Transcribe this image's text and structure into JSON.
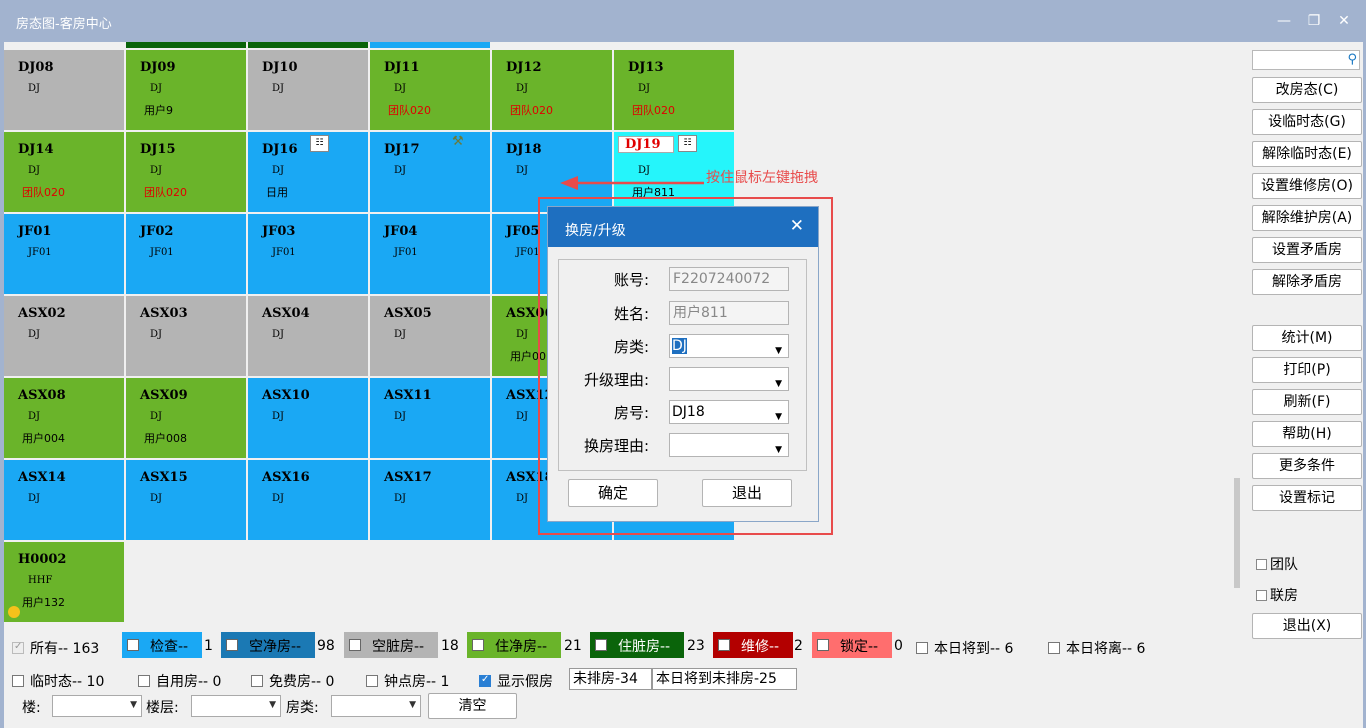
{
  "window": {
    "title": "房态图-客房中心",
    "minimize": "—",
    "restore": "❐",
    "close": "✕"
  },
  "rooms": [
    {
      "no": "DJ08",
      "type": "DJ",
      "guest": "",
      "color": "gray"
    },
    {
      "no": "DJ09",
      "type": "DJ",
      "guest": "用户9",
      "color": "green"
    },
    {
      "no": "DJ10",
      "type": "DJ",
      "guest": "",
      "color": "gray"
    },
    {
      "no": "DJ11",
      "type": "DJ",
      "guest": "团队020",
      "color": "green",
      "guestRed": true
    },
    {
      "no": "DJ12",
      "type": "DJ",
      "guest": "团队020",
      "color": "green",
      "guestRed": true
    },
    {
      "no": "DJ13",
      "type": "DJ",
      "guest": "团队020",
      "color": "green",
      "guestRed": true
    },
    {
      "no": "DJ14",
      "type": "DJ",
      "guest": "团队020",
      "color": "green",
      "guestRed": true
    },
    {
      "no": "DJ15",
      "type": "DJ",
      "guest": "团队020",
      "color": "green",
      "guestRed": true
    },
    {
      "no": "DJ16",
      "type": "DJ",
      "guest": "日用",
      "color": "blue"
    },
    {
      "no": "DJ17",
      "type": "DJ",
      "guest": "",
      "color": "blue"
    },
    {
      "no": "DJ18",
      "type": "DJ",
      "guest": "",
      "color": "blue"
    },
    {
      "no": "DJ19",
      "type": "DJ",
      "guest": "用户811",
      "color": "cyan"
    },
    {
      "no": "JF01",
      "type": "JF01",
      "guest": "",
      "color": "blue"
    },
    {
      "no": "JF02",
      "type": "JF01",
      "guest": "",
      "color": "blue"
    },
    {
      "no": "JF03",
      "type": "JF01",
      "guest": "",
      "color": "blue"
    },
    {
      "no": "JF04",
      "type": "JF01",
      "guest": "",
      "color": "blue"
    },
    {
      "no": "JF05",
      "type": "JF01",
      "guest": "",
      "color": "blue"
    },
    {
      "no": "",
      "type": "",
      "guest": "",
      "color": "blue"
    },
    {
      "no": "ASX02",
      "type": "DJ",
      "guest": "",
      "color": "gray"
    },
    {
      "no": "ASX03",
      "type": "DJ",
      "guest": "",
      "color": "gray"
    },
    {
      "no": "ASX04",
      "type": "DJ",
      "guest": "",
      "color": "gray"
    },
    {
      "no": "ASX05",
      "type": "DJ",
      "guest": "",
      "color": "gray"
    },
    {
      "no": "ASX06",
      "type": "DJ",
      "guest": "用户00",
      "color": "green"
    },
    {
      "no": "",
      "type": "",
      "guest": "",
      "color": "blue"
    },
    {
      "no": "ASX08",
      "type": "DJ",
      "guest": "用户004",
      "color": "green"
    },
    {
      "no": "ASX09",
      "type": "DJ",
      "guest": "用户008",
      "color": "green"
    },
    {
      "no": "ASX10",
      "type": "DJ",
      "guest": "",
      "color": "blue"
    },
    {
      "no": "ASX11",
      "type": "DJ",
      "guest": "",
      "color": "blue"
    },
    {
      "no": "ASX12",
      "type": "DJ",
      "guest": "",
      "color": "blue"
    },
    {
      "no": "",
      "type": "",
      "guest": "",
      "color": "blue"
    },
    {
      "no": "ASX14",
      "type": "DJ",
      "guest": "",
      "color": "blue"
    },
    {
      "no": "ASX15",
      "type": "DJ",
      "guest": "",
      "color": "blue"
    },
    {
      "no": "ASX16",
      "type": "DJ",
      "guest": "",
      "color": "blue"
    },
    {
      "no": "ASX17",
      "type": "DJ",
      "guest": "",
      "color": "blue"
    },
    {
      "no": "ASX18",
      "type": "DJ",
      "guest": "",
      "color": "blue"
    },
    {
      "no": "",
      "type": "",
      "guest": "",
      "color": "blue"
    },
    {
      "no": "H0002",
      "type": "HHF",
      "guest": "用户132",
      "color": "green"
    }
  ],
  "colors": {
    "green": "#6ab42a",
    "gray": "#b4b4b4",
    "blue": "#1aa8f4",
    "cyan": "#25f5fb",
    "darkgreen": "#0a640a",
    "red": "#e84b4b"
  },
  "sidebar": {
    "buttons": [
      "改房态(C)",
      "设临时态(G)",
      "解除临时态(E)",
      "设置维修房(O)",
      "解除维护房(A)",
      "设置矛盾房",
      "解除矛盾房",
      "统计(M)",
      "打印(P)",
      "刷新(F)",
      "帮助(H)",
      "更多条件",
      "设置标记"
    ],
    "checks": [
      "团队",
      "联房"
    ],
    "exit": "退出(X)"
  },
  "legend": {
    "all": "所有-- 163",
    "check": "检查--",
    "check_n": "1",
    "vacant_clean": "空净房--",
    "vacant_clean_n": "98",
    "vacant_dirty": "空脏房--",
    "vacant_dirty_n": "18",
    "occ_clean": "住净房--",
    "occ_clean_n": "21",
    "occ_dirty": "住脏房--",
    "occ_dirty_n": "23",
    "repair": "维修--",
    "repair_n": "2",
    "locked": "锁定--",
    "locked_n": "0",
    "arrive_today": "本日将到-- 6",
    "leave_today": "本日将离-- 6",
    "temp": "临时态-- 10",
    "self_use": "自用房-- 0",
    "free": "免费房-- 0",
    "hourly": "钟点房-- 1",
    "show_fake": "显示假房",
    "unassigned": "未排房-34",
    "arrive_unassigned": "本日将到未排房-25"
  },
  "filters": {
    "building": "楼:",
    "floor": "楼层:",
    "roomtype": "房类:",
    "clear": "清空"
  },
  "hint": "按住鼠标左键拖拽",
  "dialog": {
    "title": "换房/升级",
    "account_label": "账号:",
    "account": "F2207240072",
    "name_label": "姓名:",
    "name": "用户811",
    "roomtype_label": "房类:",
    "roomtype": "DJ",
    "reason_label": "升级理由:",
    "reason": "",
    "roomno_label": "房号:",
    "roomno": "DJ18",
    "change_reason_label": "换房理由:",
    "change_reason": "",
    "ok": "确定",
    "exit": "退出"
  }
}
